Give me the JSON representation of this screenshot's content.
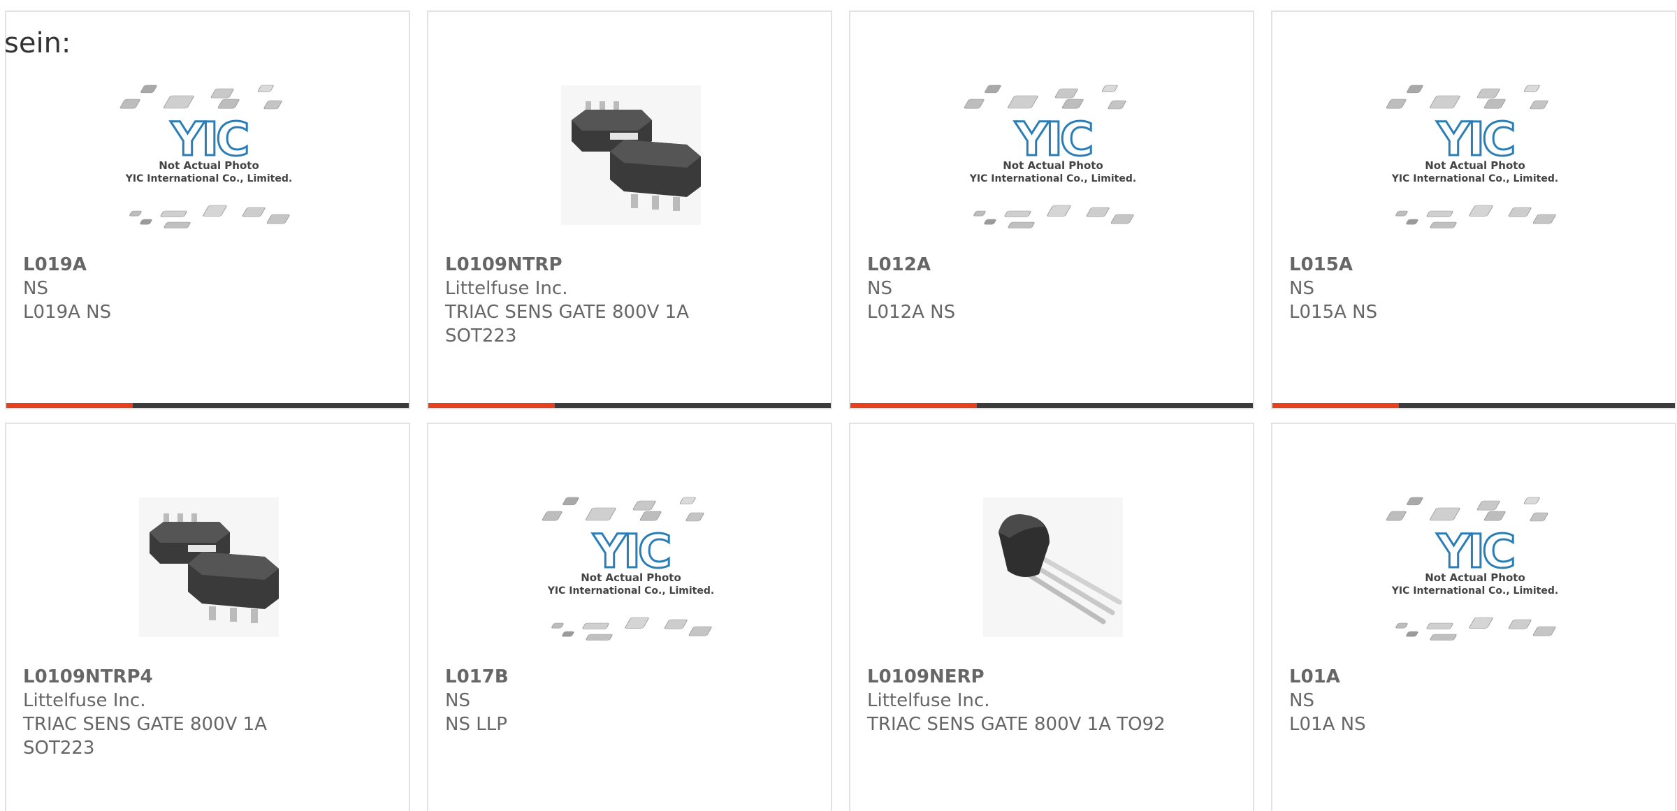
{
  "intro_text": "sein:",
  "placeholder_image": {
    "line1": "Not Actual Photo",
    "line2": "YIC International Co., Limited.",
    "logo": "YIC"
  },
  "progress_color": "#e8401c",
  "cards": [
    {
      "part_number": "L019A",
      "manufacturer": "NS",
      "description": "L019A NS",
      "image": "placeholder"
    },
    {
      "part_number": "L0109NTRP",
      "manufacturer": "Littelfuse Inc.",
      "description": "TRIAC SENS GATE 800V 1A SOT223",
      "image": "sot223"
    },
    {
      "part_number": "L012A",
      "manufacturer": "NS",
      "description": "L012A NS",
      "image": "placeholder"
    },
    {
      "part_number": "L015A",
      "manufacturer": "NS",
      "description": "L015A NS",
      "image": "placeholder"
    },
    {
      "part_number": "L0109NTRP4",
      "manufacturer": "Littelfuse Inc.",
      "description": "TRIAC SENS GATE 800V 1A SOT223",
      "image": "sot223"
    },
    {
      "part_number": "L017B",
      "manufacturer": "NS",
      "description": "NS LLP",
      "image": "placeholder"
    },
    {
      "part_number": "L0109NERP",
      "manufacturer": "Littelfuse Inc.",
      "description": "TRIAC SENS GATE 800V 1A TO92",
      "image": "to92"
    },
    {
      "part_number": "L01A",
      "manufacturer": "NS",
      "description": "L01A NS",
      "image": "placeholder"
    }
  ]
}
